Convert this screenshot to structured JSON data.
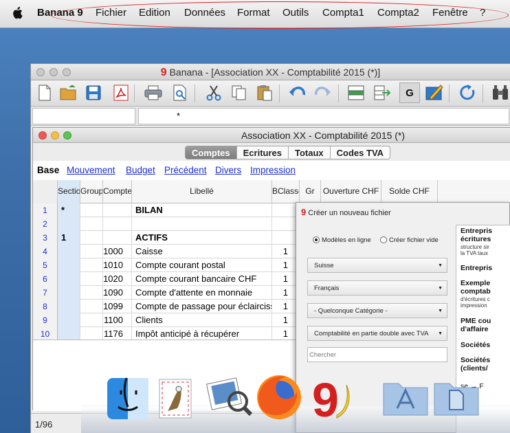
{
  "menubar": {
    "app_name": "Banana 9",
    "items": [
      "Fichier",
      "Edition",
      "Données",
      "Format",
      "Outils",
      "Compta1",
      "Compta2",
      "Fenêtre",
      "?"
    ]
  },
  "main_window": {
    "title_logo": "9",
    "title": "Banana - [Association XX - Comptabilité 2015 (*)]",
    "formula_value": "*"
  },
  "doc_window": {
    "title": "Association XX - Comptabilité 2015 (*)",
    "tabs": [
      "Comptes",
      "Ecritures",
      "Totaux",
      "Codes TVA"
    ],
    "active_tab": "Comptes",
    "subtabs": [
      "Base",
      "Mouvement",
      "Budget",
      "Précédent",
      "Divers",
      "Impression"
    ],
    "active_subtab": "Base",
    "columns": [
      "Section",
      "Groupe",
      "Compte",
      "Libellé",
      "BClasse",
      "Gr",
      "Ouverture CHF",
      "Solde CHF"
    ],
    "rows": [
      {
        "num": "1",
        "section": "*",
        "compte": "",
        "libelle": "BILAN",
        "bclasse": "",
        "bold": true
      },
      {
        "num": "2",
        "section": "",
        "compte": "",
        "libelle": "",
        "bclasse": "",
        "bold": false
      },
      {
        "num": "3",
        "section": "1",
        "compte": "",
        "libelle": "ACTIFS",
        "bclasse": "",
        "bold": true
      },
      {
        "num": "4",
        "section": "",
        "compte": "1000",
        "libelle": "Caisse",
        "bclasse": "1",
        "bold": false
      },
      {
        "num": "5",
        "section": "",
        "compte": "1010",
        "libelle": "Compte courant postal",
        "bclasse": "1",
        "bold": false
      },
      {
        "num": "6",
        "section": "",
        "compte": "1020",
        "libelle": "Compte courant bancaire CHF",
        "bclasse": "1",
        "bold": false
      },
      {
        "num": "7",
        "section": "",
        "compte": "1090",
        "libelle": "Compte d'attente en monnaie",
        "bclasse": "1",
        "bold": false
      },
      {
        "num": "8",
        "section": "",
        "compte": "1099",
        "libelle": "Compte de passage pour éclaircisser",
        "bclasse": "1",
        "bold": false
      },
      {
        "num": "9",
        "section": "",
        "compte": "1100",
        "libelle": "Clients",
        "bclasse": "1",
        "bold": false
      },
      {
        "num": "10",
        "section": "",
        "compte": "1176",
        "libelle": "Impôt anticipé à récupérer",
        "bclasse": "1",
        "bold": false
      }
    ],
    "status_position": "1/96"
  },
  "dialog": {
    "logo": "9",
    "title": "Créer un nouveau fichier",
    "radio_online": "Modèles en ligne",
    "radio_empty": "Créer fichier vide",
    "select_country": "Suisse",
    "select_language": "Français",
    "select_category": "- Quelconque Catégorie -",
    "select_type": "Comptabilité en partie double avec TVA",
    "search_placeholder": "Chercher",
    "descriptions": {
      "d1_title": "Entrepris",
      "d1_sub": "écritures",
      "d1_s1": "structure sir",
      "d1_s2": "la TVA taux",
      "d2_title": "Entrepris",
      "d3_title": "Exemple",
      "d3_sub": "comptab",
      "d3_s1": "d'écritures c",
      "d3_s2": "impression",
      "d4_title": "PME cou",
      "d4_sub": "d'affaire",
      "d5_title": "Sociétés",
      "d6_title": "Sociétés",
      "d6_sub": "(clients/",
      "d7": "se → F"
    }
  },
  "colors": {
    "accent_red": "#d41f1f",
    "link_blue": "#1f2fcf",
    "highlight_ellipse": "#dd2222"
  }
}
